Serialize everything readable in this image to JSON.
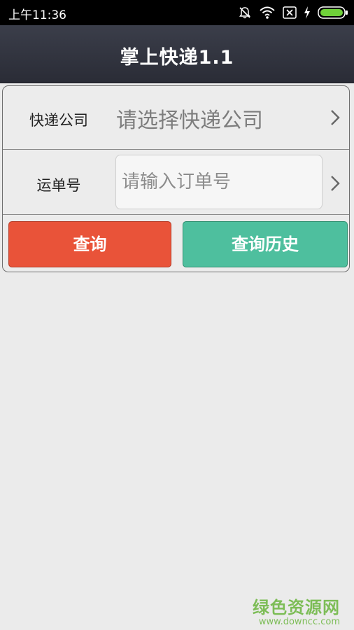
{
  "status_bar": {
    "time": "上午11:36",
    "icons": [
      "mute-icon",
      "wifi-icon",
      "sim-icon",
      "charging-icon",
      "battery-icon"
    ]
  },
  "app_bar": {
    "title": "掌上快递1.1"
  },
  "form": {
    "company_label": "快递公司",
    "company_placeholder": "请选择快递公司",
    "waybill_label": "运单号",
    "waybill_placeholder": "请输入订单号",
    "waybill_value": ""
  },
  "buttons": {
    "query_label": "查询",
    "history_label": "查询历史"
  },
  "watermark": {
    "name": "绿色资源网",
    "url": "www.downcc.com"
  },
  "colors": {
    "app_bar": "#2f323d",
    "query_button": "#e95339",
    "history_button": "#4ebf9e",
    "background": "#ebebeb",
    "watermark": "#7dbd57"
  }
}
